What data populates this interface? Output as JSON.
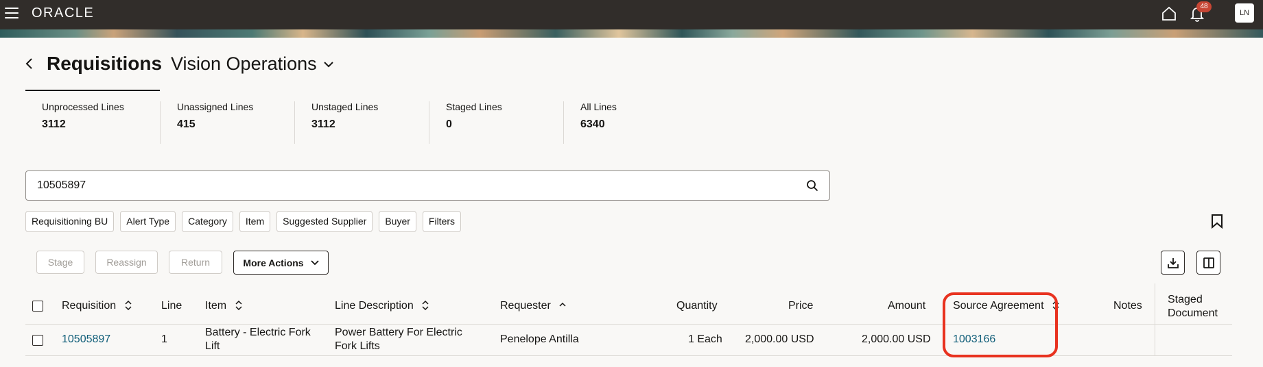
{
  "topbar": {
    "logo": "ORACLE",
    "notification_count": "48",
    "user_initials": "LN"
  },
  "header": {
    "title": "Requisitions",
    "business_unit": "Vision Operations"
  },
  "metrics": [
    {
      "label": "Unprocessed Lines",
      "value": "3112"
    },
    {
      "label": "Unassigned Lines",
      "value": "415"
    },
    {
      "label": "Unstaged Lines",
      "value": "3112"
    },
    {
      "label": "Staged Lines",
      "value": "0"
    },
    {
      "label": "All Lines",
      "value": "6340"
    }
  ],
  "search": {
    "value": "10505897"
  },
  "filters": [
    "Requisitioning BU",
    "Alert Type",
    "Category",
    "Item",
    "Suggested Supplier",
    "Buyer",
    "Filters"
  ],
  "actions": {
    "stage": "Stage",
    "reassign": "Reassign",
    "return": "Return",
    "more": "More Actions"
  },
  "table": {
    "columns": {
      "requisition": "Requisition",
      "line": "Line",
      "item": "Item",
      "line_description": "Line Description",
      "requester": "Requester",
      "quantity": "Quantity",
      "price": "Price",
      "amount": "Amount",
      "source_agreement": "Source Agreement",
      "notes": "Notes",
      "staged_document_1": "Staged",
      "staged_document_2": "Document"
    },
    "rows": [
      {
        "requisition": "10505897",
        "line": "1",
        "item_1": "Battery - Electric Fork",
        "item_2": "Lift",
        "desc_1": "Power Battery For Electric",
        "desc_2": "Fork Lifts",
        "requester": "Penelope Antilla",
        "quantity": "1 Each",
        "price": "2,000.00 USD",
        "amount": "2,000.00 USD",
        "source_agreement": "1003166",
        "notes": "",
        "staged_document": ""
      }
    ]
  },
  "colors": {
    "topbar": "#312d2a",
    "link": "#0f5d78",
    "badge": "#c74634",
    "highlight": "#e8321f"
  }
}
